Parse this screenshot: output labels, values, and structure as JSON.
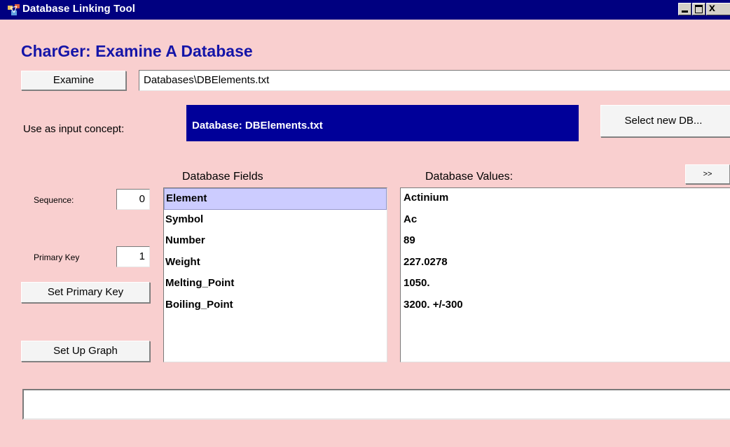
{
  "window": {
    "title": "Database Linking Tool",
    "close_glyph": "x"
  },
  "heading": "CharGer: Examine A Database",
  "examine": {
    "button_label": "Examine",
    "path_value": "Databases\\DBElements.txt"
  },
  "concept": {
    "label": "Use as input concept:",
    "value": "Database:  DBElements.txt",
    "select_button_label": "Select new DB..."
  },
  "fields": {
    "header": "Database Fields",
    "items": [
      "Element",
      "Symbol",
      "Number",
      "Weight",
      "Melting_Point",
      "Boiling_Point"
    ],
    "selected_index": 0
  },
  "values": {
    "header": "Database Values:",
    "expand_button_label": ">>",
    "items": [
      "Actinium",
      "Ac",
      "89",
      "227.0278",
      "1050.",
      "3200. +/-300"
    ]
  },
  "sequence": {
    "label": "Sequence:",
    "value": "0"
  },
  "primary_key": {
    "label": "Primary Key",
    "value": "1",
    "button_label": "Set Primary Key"
  },
  "setup_graph": {
    "button_label": "Set Up Graph"
  },
  "status": {
    "value": ""
  },
  "colors": {
    "background": "#f9cfcf",
    "titlebar": "#000080",
    "heading": "#1515a8",
    "concept_box": "#000099",
    "selection": "#ccccff"
  }
}
